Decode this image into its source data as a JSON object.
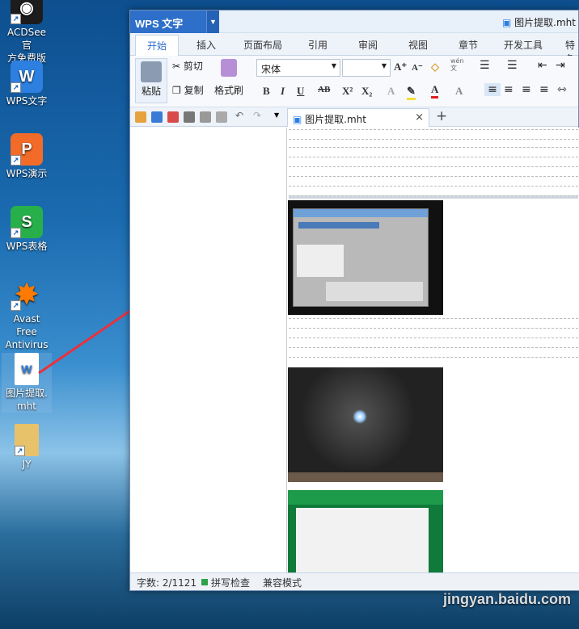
{
  "desktop": {
    "icons": [
      {
        "label": "ACDSee 官\n方免费版",
        "icon": "acdsee-icon",
        "color": "#1c1c1c"
      },
      {
        "label": "WPS文字",
        "icon": "wps-writer-icon",
        "color": "#2d7fe0"
      },
      {
        "label": "WPS演示",
        "icon": "wps-presentation-icon",
        "color": "#f26b28"
      },
      {
        "label": "WPS表格",
        "icon": "wps-spreadsheet-icon",
        "color": "#27b04a"
      },
      {
        "label": "Avast Free\nAntivirus",
        "icon": "avast-icon",
        "color": "#ff7a00"
      },
      {
        "label": "图片提取.\nmht",
        "icon": "mht-file-icon",
        "color": "#ffffff"
      },
      {
        "label": "JY",
        "icon": "folder-icon",
        "color": "#e8c26a"
      }
    ],
    "watermark": "Bai 经验\njingyan.baidu.com"
  },
  "window": {
    "app_name": "WPS 文字",
    "doc_title": "图片提取.mht",
    "tabs": [
      "开始",
      "插入",
      "页面布局",
      "引用",
      "审阅",
      "视图",
      "章节",
      "开发工具",
      "特色"
    ],
    "ribbon": {
      "paste": "粘贴",
      "cut": "剪切",
      "copy": "复制",
      "format_painter": "格式刷",
      "font_name": "宋体",
      "font_size": "",
      "wen": "wén\n文"
    },
    "doc_tab_label": "图片提取.mht",
    "status": {
      "word_count": "字数: 2/1121",
      "spell_check": "拼写检查",
      "compat_mode": "兼容模式"
    }
  }
}
